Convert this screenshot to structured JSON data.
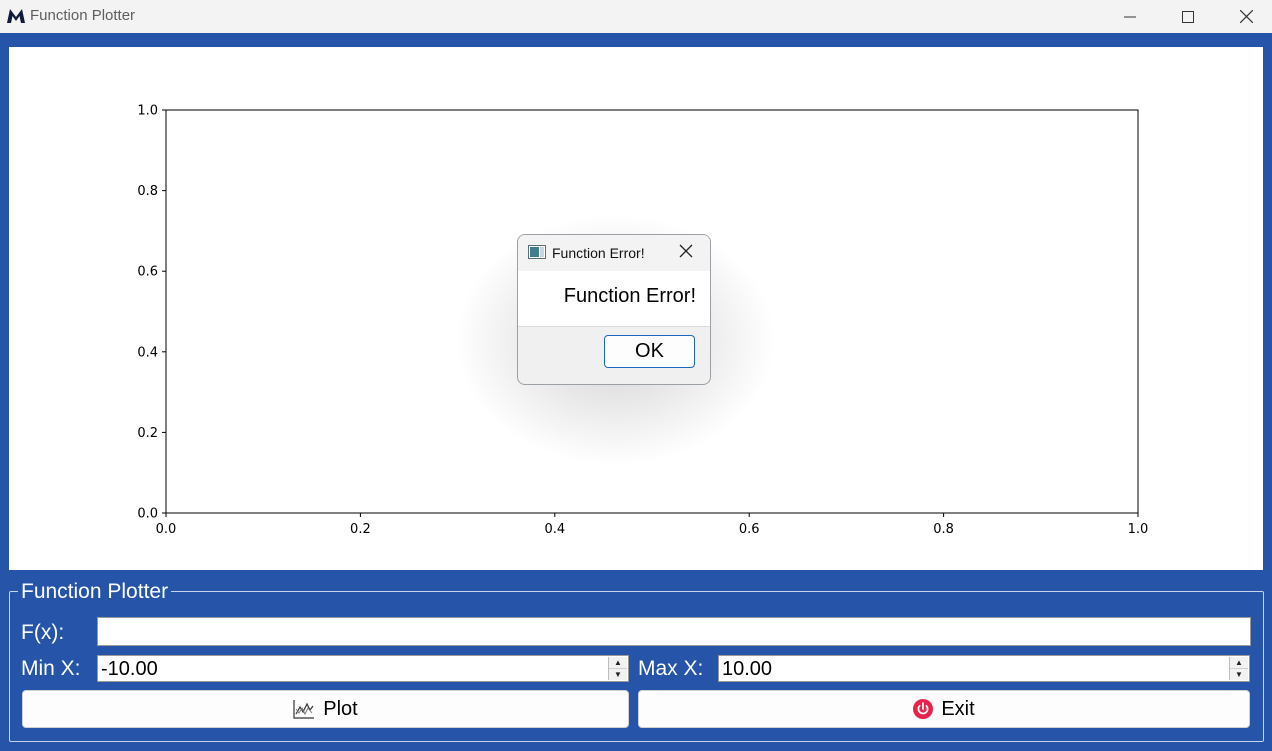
{
  "window": {
    "title": "Function Plotter",
    "icon": "app-logo-m-icon"
  },
  "dialog": {
    "title": "Function Error!",
    "message": "Function Error!",
    "ok_label": "OK"
  },
  "chart_data": {
    "type": "line",
    "series": [],
    "xlim": [
      0.0,
      1.0
    ],
    "ylim": [
      0.0,
      1.0
    ],
    "xticks": [
      "0.0",
      "0.2",
      "0.4",
      "0.6",
      "0.8",
      "1.0"
    ],
    "yticks": [
      "0.0",
      "0.2",
      "0.4",
      "0.6",
      "0.8",
      "1.0"
    ],
    "grid": false
  },
  "controls": {
    "group_title": "Function Plotter",
    "fx_label": "F(x):",
    "fx_value": "",
    "min_label": "Min X:",
    "min_value": "-10.00",
    "max_label": "Max X:",
    "max_value": "10.00",
    "plot_label": "Plot",
    "exit_label": "Exit"
  },
  "colors": {
    "window_bg": "#2654a8",
    "exit_icon": "#e8224a",
    "dialog_ok_border": "#1a67c0"
  }
}
